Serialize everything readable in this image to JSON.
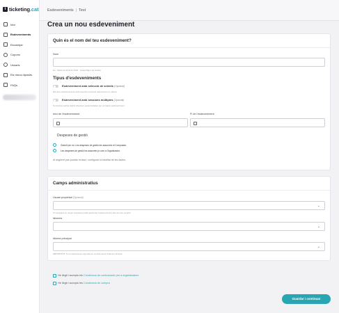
{
  "app": {
    "logo_prefix": "ticketing",
    "logo_suffix": ".cat",
    "logo_mark": "t"
  },
  "breadcrumb": {
    "first": "Esdeveniments",
    "separator": "|",
    "second": "Test"
  },
  "nav": {
    "items": [
      {
        "label": "Inici",
        "icon": "home-icon"
      },
      {
        "label": "Esdeveniments",
        "icon": "calendar-icon"
      },
      {
        "label": "Escanejar",
        "icon": "scan-icon"
      },
      {
        "label": "Cupons",
        "icon": "coupon-icon"
      },
      {
        "label": "Usuaris",
        "icon": "users-icon"
      },
      {
        "label": "Els meus dipòsits",
        "icon": "wallet-icon"
      },
      {
        "label": "FAQs",
        "icon": "help-icon"
      }
    ]
  },
  "page_title": "Crea un nou esdeveniment",
  "basics": {
    "title": "Quin és el nom del teu esdeveniment?",
    "name_label": "Nom",
    "name_value": "",
    "name_hint": "Ex.: Santa Jordi Rock 2024 · Festa Major de Gràcia"
  },
  "types": {
    "title": "Tipus d'esdeveniments",
    "seated_label": "Esdeveniment amb selecció de seients",
    "seated_optional": "(Opcional)",
    "seated_hint": "Els teus esdeveniments amb seients numerats requereixen un plànol",
    "multi_label": "Esdeveniment amb sessions múltiples",
    "multi_optional": "(Opcional)",
    "multi_hint": "Si s'activa podràs definir diverses sessions/dates per al mateix esdeveniment",
    "start_label": "Inici de l'esdeveniment",
    "end_label": "Fi de l'esdeveniment"
  },
  "fees": {
    "title": "Despeses de gestió",
    "option1": "Gratuït per mi. Les despeses de gestió les assumeix el Comprador.",
    "option2": "Les despeses de gestió les assumeix jo com a Organitzador.",
    "note": "Al següent pas podràs revisar i configurar la totalitat de les dades."
  },
  "admin": {
    "title": "Camps administratius",
    "owner_label": "Usuari propietari",
    "owner_optional": "(Opcional)",
    "owner_hint": "Si s'assigna un usuari propietari podrà gestionar l'esdeveniment des del seu compte",
    "languages_label": "Idiomes",
    "main_language_label": "Idioma principal",
    "main_language_hint": "IMPORTANT: Si no selecciones cap idioma, es farà servir l'idioma principal"
  },
  "terms": {
    "check1_prefix": "He llegit i accepto els",
    "check1_link": "Condicions de contractació per a organitzadors",
    "check2_prefix": "He llegit i accepto les",
    "check2_link": "Condicions de compra"
  },
  "actions": {
    "save_label": "Guardar i continuar"
  },
  "colors": {
    "accent": "#2aa6b3",
    "title": "#1e1e28"
  }
}
